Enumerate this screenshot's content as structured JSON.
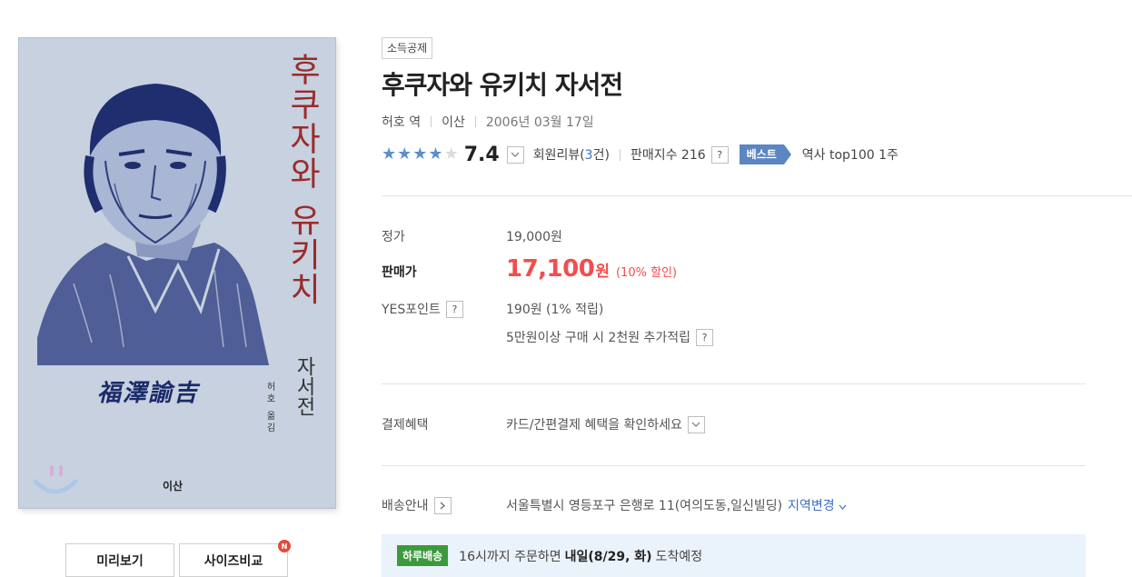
{
  "cover": {
    "title_vertical": "후쿠자와 유키치",
    "subtitle_vertical": "자서전",
    "translator_vertical": "허호 옮김",
    "kanji_name": "福澤諭吉",
    "publisher_mark": "이산"
  },
  "preview_buttons": {
    "preview_label": "미리보기",
    "size_label": "사이즈비교",
    "new_badge": "N"
  },
  "product": {
    "tag": "소득공제",
    "title": "후쿠자와 유키치 자서전",
    "author": "허호 역",
    "publisher": "이산",
    "date": "2006년 03월 17일",
    "rating": {
      "stars_filled": 4,
      "stars_total": 5,
      "score": "7.4",
      "review_prefix": "회원리뷰(",
      "review_count": "3",
      "review_suffix": "건)",
      "sales_index": "판매지수 216",
      "help": "?",
      "best_label": "베스트",
      "rank_text": "역사 top100 1주"
    }
  },
  "price": {
    "list_label": "정가",
    "list_value": "19,000원",
    "sale_label": "판매가",
    "sale_value": "17,100",
    "sale_unit": "원",
    "discount": "(10% 할인)",
    "points_label": "YES포인트",
    "points_value": "190원 (1% 적립)",
    "points_extra": "5만원이상 구매 시 2천원 추가적립",
    "help": "?"
  },
  "benefit": {
    "label": "결제혜택",
    "text": "카드/간편결제 혜택을 확인하세요"
  },
  "shipping": {
    "label": "배송안내",
    "address": "서울특별시 영등포구 은행로 11(여의도동,일신빌딩)",
    "change_link": "지역변경",
    "oneday_badge": "하루배송",
    "message_pre": "16시까지 주문하면",
    "message_bold": "내일(8/29, 화)",
    "message_post": "도착예정"
  },
  "colors": {
    "accent_blue": "#5b86c2",
    "sale_red": "#f24e4e",
    "oneday_green": "#3c9a3c",
    "star_blue": "#5b8fcd"
  }
}
